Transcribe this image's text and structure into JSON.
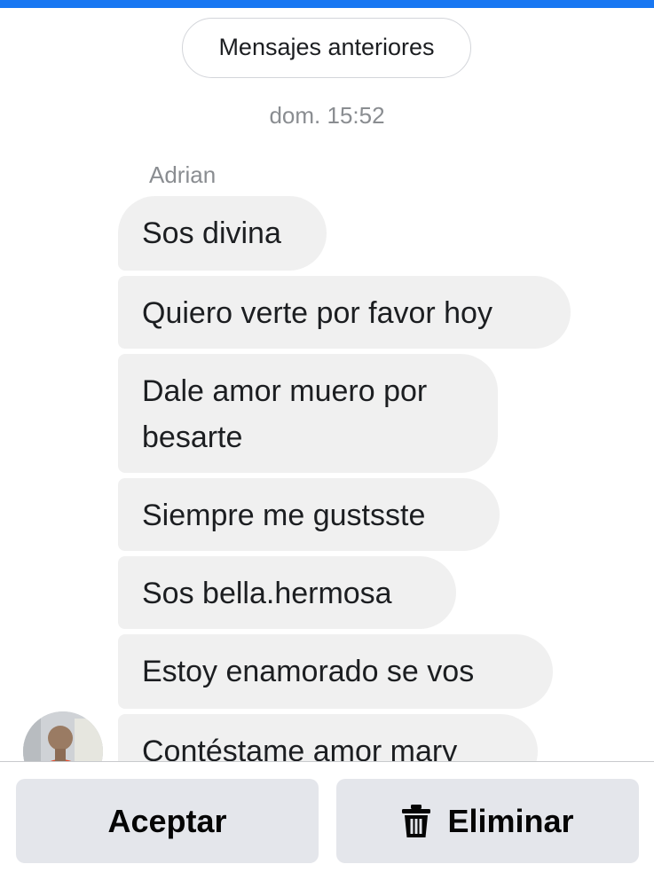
{
  "colors": {
    "accent": "#1877f2",
    "bubble": "#f0f0f0",
    "button_bg": "#e4e6eb",
    "muted_text": "#8a8d91"
  },
  "thread": {
    "older_messages_label": "Mensajes anteriores",
    "timestamp": "dom. 15:52",
    "sender_name": "Adrian",
    "messages": [
      {
        "text": "Sos divina"
      },
      {
        "text": "Quiero verte por favor hoy"
      },
      {
        "text": "Dale amor muero por besarte"
      },
      {
        "text": "Siempre me gustsste"
      },
      {
        "text": "Sos bella.hermosa"
      },
      {
        "text": "Estoy enamorado se vos"
      },
      {
        "text": "Contéstame amor mary"
      }
    ],
    "avatar_icon": "user-avatar"
  },
  "request_actions": {
    "accept_label": "Aceptar",
    "delete_label": "Eliminar",
    "delete_icon": "trash-icon"
  }
}
